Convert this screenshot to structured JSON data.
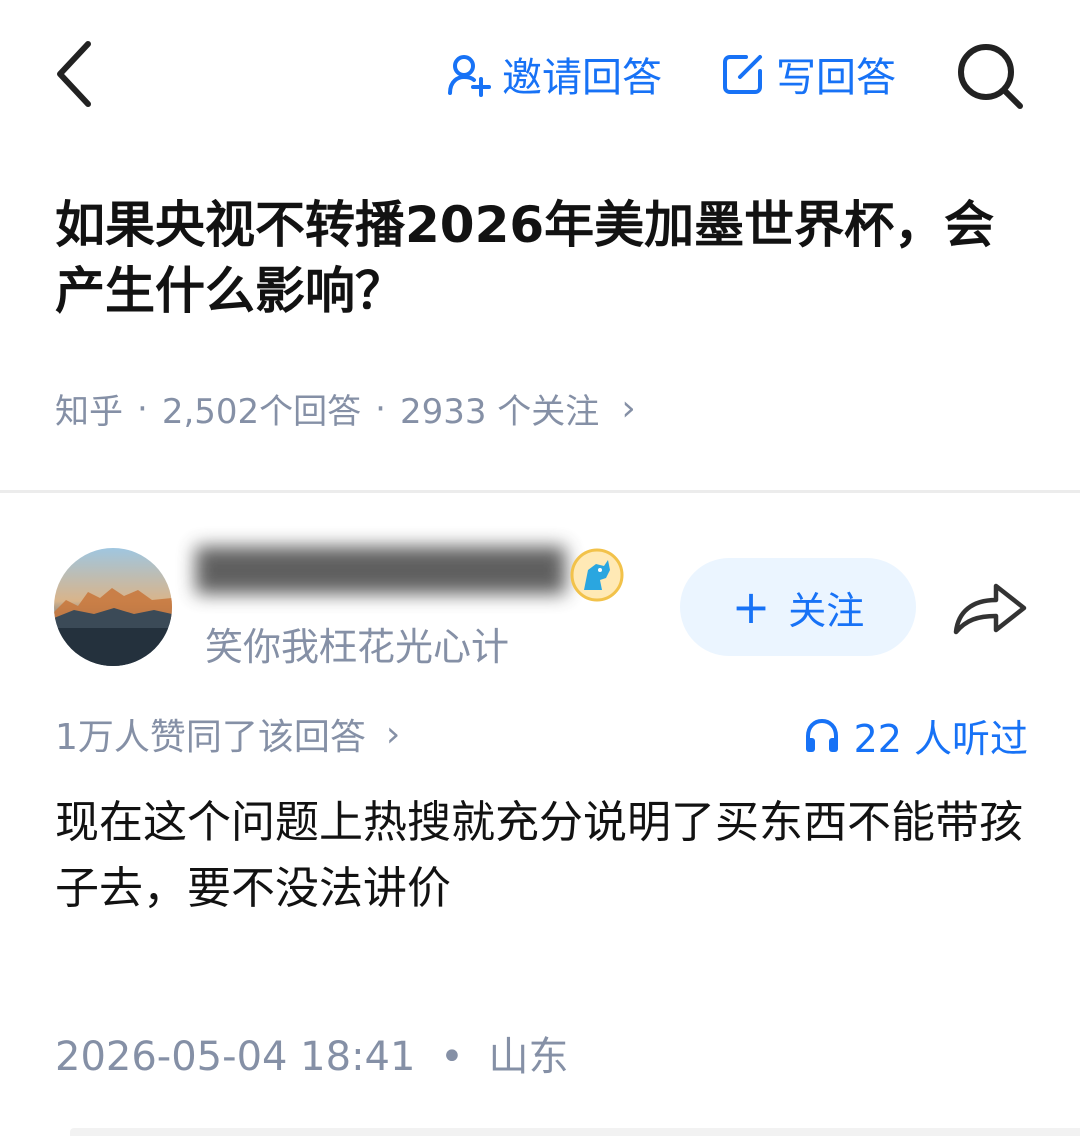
{
  "toolbar": {
    "invite_label": "邀请回答",
    "write_label": "写回答",
    "accent_color": "#1772F6"
  },
  "question": {
    "title": "如果央视不转播2026年美加墨世界杯，会产生什么影响？",
    "source": "知乎",
    "answers_count": "2,502个回答",
    "followers_count": "2933 个关注",
    "separator": "·",
    "chevron": "›"
  },
  "author": {
    "name": "████████████",
    "bio": "笑你我枉花光心计",
    "follow_label": "关注",
    "follow_plus": "+"
  },
  "answer": {
    "votes_text": "1万人赞同了该回答",
    "votes_chevron": "›",
    "listen_text": "22 人听过",
    "content": "现在这个问题上热搜就充分说明了买东西不能带孩子去，要不没法讲价",
    "datetime": "2026-05-04 18:41",
    "separator": "•",
    "location": "山东"
  },
  "icons": {
    "back": "chevron-left-icon",
    "invite": "user-plus-icon",
    "write": "edit-icon",
    "search": "search-icon",
    "share": "share-arrow-icon",
    "listen": "headphones-icon"
  }
}
